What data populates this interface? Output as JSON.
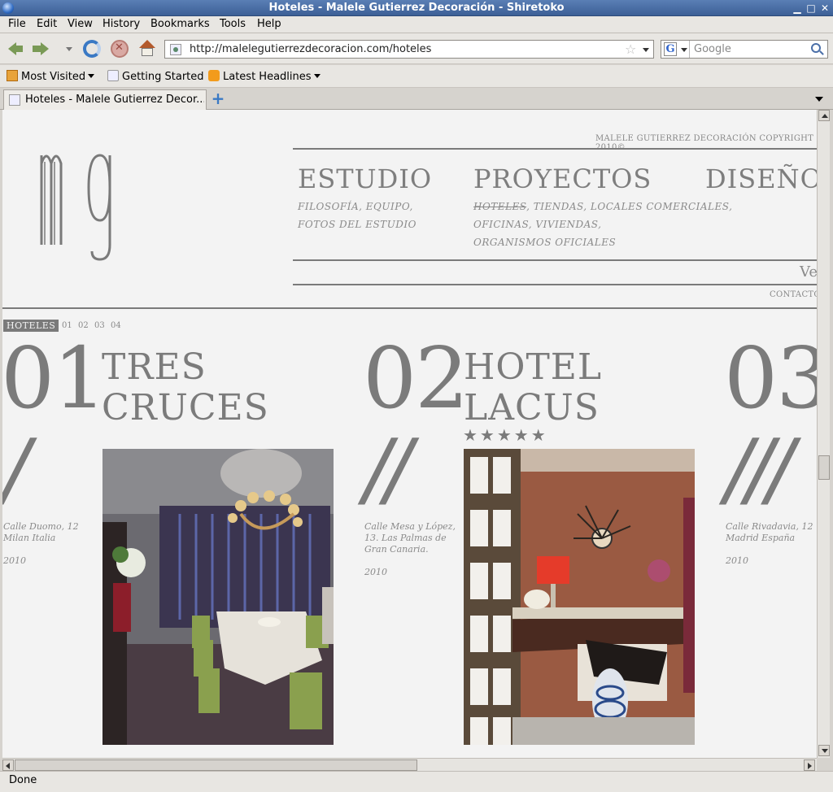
{
  "window": {
    "title": "Hoteles - Malele Gutierrez Decoración - Shiretoko"
  },
  "menubar": {
    "items": [
      "File",
      "Edit",
      "View",
      "History",
      "Bookmarks",
      "Tools",
      "Help"
    ]
  },
  "navbar": {
    "url": "http://malelegutierrezdecoracion.com/hoteles",
    "search_placeholder": "Google"
  },
  "bookmarks": {
    "items": [
      "Most Visited",
      "Getting Started",
      "Latest Headlines"
    ]
  },
  "tabs": {
    "active_label": "Hoteles - Malele Gutierrez Decor..."
  },
  "status": {
    "text": "Done"
  },
  "site": {
    "copyright": "MALELE GUTIERREZ DECORACIÓN COPYRIGHT 2010©",
    "nav": [
      {
        "heading": "ESTUDIO",
        "sub": [
          "FILOSOFÍA, EQUIPO,",
          "FOTOS DEL ESTUDIO"
        ]
      },
      {
        "heading": "PROYECTOS",
        "sub_strike": "HOTELES",
        "sub_after": ", TIENDAS, LOCALES COMERCIALES,",
        "sub": [
          "OFICINAS, VIVIENDAS,",
          "ORGANISMOS OFICIALES"
        ]
      },
      {
        "heading": "DISEÑO"
      }
    ],
    "ve": "Ve",
    "contacto": "CONTACTO",
    "section_tag": "HOTELES",
    "pages": [
      "01",
      "02",
      "03",
      "04"
    ],
    "hotels": [
      {
        "num": "01",
        "title_1": "TRES",
        "title_2": "CRUCES",
        "slash": "/",
        "address": "Calle Duomo, 12 Milan Italia",
        "year": "2010"
      },
      {
        "num": "02",
        "title_1": "HOTEL",
        "title_2": "LACUS",
        "stars": "★★★★★",
        "slash": "//",
        "address": "Calle Mesa y López, 13. Las Palmas de Gran Canaria.",
        "year": "2010"
      },
      {
        "num": "03",
        "slash": "///",
        "address": "Calle Rivadavia, 12 Madrid España",
        "year": "2010"
      }
    ]
  },
  "colors": {
    "page_bg": "#f3f3f3",
    "text_gray": "#7b7b7b",
    "titlebar": "#3c5f96"
  }
}
